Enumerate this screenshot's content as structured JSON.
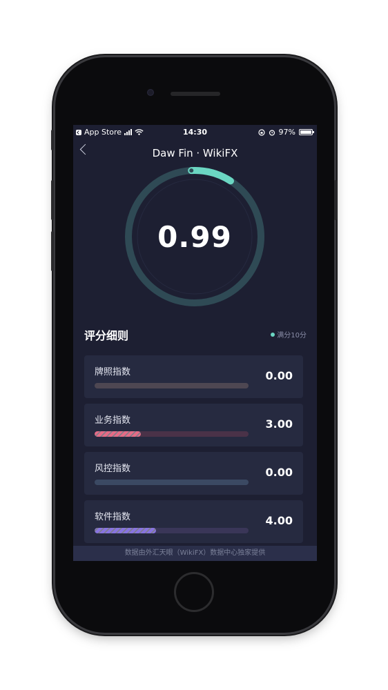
{
  "status_bar": {
    "back_app": "App Store",
    "time": "14:30",
    "battery": "97%"
  },
  "nav": {
    "title": "Daw Fin · WikiFX"
  },
  "score": {
    "value": "0.99",
    "fraction_of_max": 0.099
  },
  "breakdown": {
    "title": "评分细则",
    "full_score_label": "满分10分",
    "items": [
      {
        "label": "牌照指数",
        "value": "0.00",
        "fraction": 0.0,
        "track_color": "#4e4752",
        "fill_color": "#4e4752"
      },
      {
        "label": "业务指数",
        "value": "3.00",
        "fraction": 0.3,
        "track_color": "#4a3248",
        "fill_color": "#e56b86"
      },
      {
        "label": "风控指数",
        "value": "0.00",
        "fraction": 0.0,
        "track_color": "#3b4963",
        "fill_color": "#3b4963"
      },
      {
        "label": "软件指数",
        "value": "4.00",
        "fraction": 0.4,
        "track_color": "#3a3658",
        "fill_color": "#8874e0"
      }
    ]
  },
  "footer": {
    "text": "数据由外汇天眼（WikiFX）数据中心独家提供"
  },
  "colors": {
    "background": "#1d1f32",
    "ring": "#2f4a55",
    "ring_progress": "#6bd6c2"
  }
}
